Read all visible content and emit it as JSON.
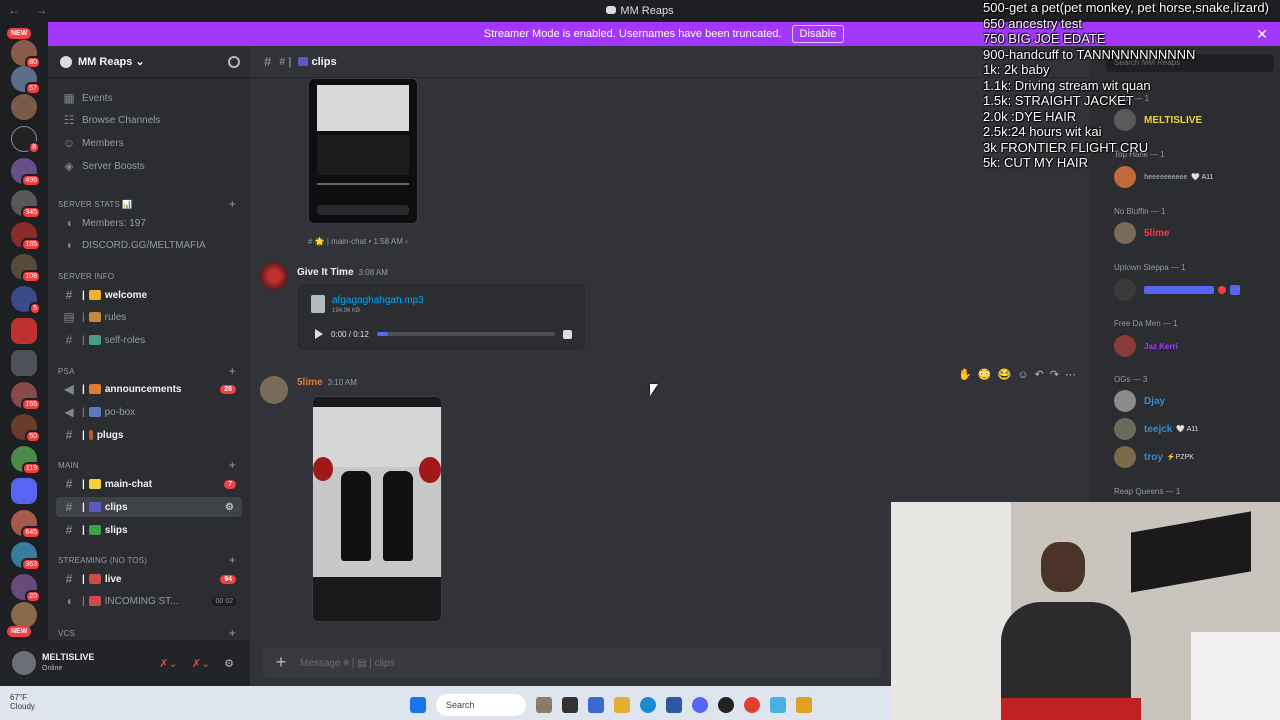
{
  "titlebar": {
    "title": "MM Reaps",
    "nav": "← →"
  },
  "banner": {
    "text": "Streamer Mode is enabled. Usernames have been truncated.",
    "button": "Disable",
    "close": "✕"
  },
  "servers": {
    "new_top": "NEW",
    "new_bottom": "NEW",
    "badges": [
      "80",
      "57",
      "8",
      "496",
      "345",
      "185",
      "108",
      "5",
      "166",
      "50",
      "119",
      "645",
      "363",
      "20"
    ]
  },
  "sidebar": {
    "server_name": "MM Reaps",
    "top_items": [
      "Events",
      "Browse Channels",
      "Members",
      "Server Boosts"
    ],
    "cat_stats": "SERVER STATS 📊",
    "stats": [
      "Members: 197",
      "DISCORD.GG/MELTMAFIA"
    ],
    "cat_info": "SERVER INFO",
    "info_channels": [
      "welcome",
      "rules",
      "self-roles"
    ],
    "cat_psa": "PSA",
    "psa_channels": [
      "announcements",
      "po-box",
      "plugs"
    ],
    "announcements_count": "26",
    "cat_main": "MAIN",
    "main_channels": [
      "main-chat",
      "clips",
      "slips"
    ],
    "main_chat_count": "7",
    "cat_streaming": "STREAMING (NO TOS)",
    "streaming_channels": [
      "live",
      "INCOMING ST..."
    ],
    "live_count": "94",
    "incoming_counts": "00  02",
    "cat_vcs": "VCs"
  },
  "user": {
    "name": "MELTISLIVE",
    "status": "Online"
  },
  "channel": {
    "name": "clips",
    "prefix": "#  |"
  },
  "messages": {
    "forward_meta": "# 🌟 | main-chat • 1:58 AM ›",
    "m1": {
      "author": "Give It Time",
      "time": "3:08 AM",
      "file_name": "afgagaghahgah.mp3",
      "file_size": "194.96 KB",
      "player_time": "0:00 / 0:12"
    },
    "m2": {
      "author": "5lime",
      "time": "3:10 AM"
    }
  },
  "composer": {
    "placeholder": "Message # |  ▤  | clips"
  },
  "members": {
    "search": "Search MM Reaps",
    "groups": [
      {
        "label": "Baby — 1",
        "members": [
          {
            "name": "MELTISLIVE",
            "tag": ""
          }
        ]
      },
      {
        "label": "Top Hank — 1",
        "members": [
          {
            "name": "heeeeeeeeee",
            "tag": "🤍 A11"
          }
        ]
      },
      {
        "label": "No Bluffin — 1",
        "members": [
          {
            "name": "5lime",
            "tag": ""
          }
        ]
      },
      {
        "label": "Uptown Steppa — 1",
        "members": [
          {
            "name": "",
            "tag": ""
          }
        ]
      },
      {
        "label": "Free Da Men — 1",
        "members": [
          {
            "name": "Jaz Kerri",
            "tag": ""
          }
        ]
      },
      {
        "label": "OGs — 3",
        "members": [
          {
            "name": "Djay",
            "tag": ""
          },
          {
            "name": "teejck",
            "tag": "🤍 A11"
          },
          {
            "name": "troy",
            "tag": "⚡PZPK"
          }
        ]
      },
      {
        "label": "Reap Queens — 1",
        "members": []
      }
    ]
  },
  "overlay": {
    "lines": [
      "500-get a pet(pet monkey, pet horse,snake,lizard)",
      "650 ancestry test",
      "750 BIG JOE EDATE",
      "900-handcuff to TANNNNNNNNNNN",
      "1k: 2k baby",
      "1.1k: Driving stream wit quan",
      "1.5k: STRAIGHT JACKET",
      "2.0k :DYE HAIR",
      "2.5k:24 hours wit kai",
      "3k FRONTIER FLIGHT CRU",
      "5k: CUT MY HAIR"
    ]
  },
  "taskbar": {
    "temp": "67°F",
    "weather": "Cloudy",
    "search": "Search"
  },
  "colors": {
    "accent": "#a238ff",
    "blurple": "#5865f2",
    "red": "#f23f43",
    "link": "#00a8fc"
  }
}
